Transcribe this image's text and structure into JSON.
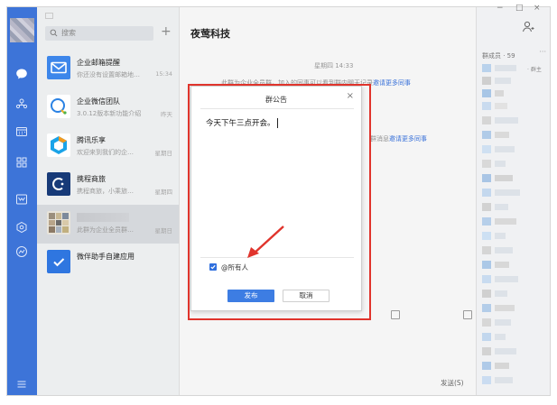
{
  "colors": {
    "rail": "#3d74d8",
    "accent": "#3a72d9",
    "annotation": "#e0342c"
  },
  "search": {
    "placeholder": "搜索"
  },
  "sessions": [
    {
      "title": "企业邮箱提醒",
      "preview": "你还没有设置邮箱地…",
      "time": "15:34",
      "icon": "mail-icon"
    },
    {
      "title": "企业微信团队",
      "preview": "3.0.12版本新功能介绍",
      "time": "昨天",
      "icon": "wework-team-icon"
    },
    {
      "title": "腾讯乐享",
      "preview": "欢迎来到我们的企…",
      "time": "星期日",
      "icon": "lexiang-icon"
    },
    {
      "title": "携程商旅",
      "preview": "携程商旅，小乘旅…",
      "time": "星期四",
      "icon": "ctrip-icon"
    },
    {
      "title": "",
      "preview": "此群为企业全员群…",
      "time": "星期日",
      "icon": "group-avatar"
    },
    {
      "title": "微伴助手自建应用",
      "preview": "",
      "time": "",
      "icon": "app-check-icon"
    }
  ],
  "chat": {
    "title": "夜莺科技",
    "date": "星期四 14:33",
    "sys1": "此群为企业全员群，加入的同事可以看到群内聊天记录",
    "sys1_link": "邀请更多同事",
    "sys2": "群消息",
    "sys2_link": "邀请更多同事",
    "send": "发送(S)"
  },
  "members": {
    "header": "群成员 · 59",
    "more": "···",
    "owner_tag": "· 群主"
  },
  "dialog": {
    "title": "群公告",
    "close": "×",
    "content": "今天下午三点开会。",
    "checkbox_label": "@所有人",
    "publish": "发布",
    "cancel": "取消"
  },
  "window": {
    "min": "−",
    "max": "□",
    "close": "×"
  }
}
